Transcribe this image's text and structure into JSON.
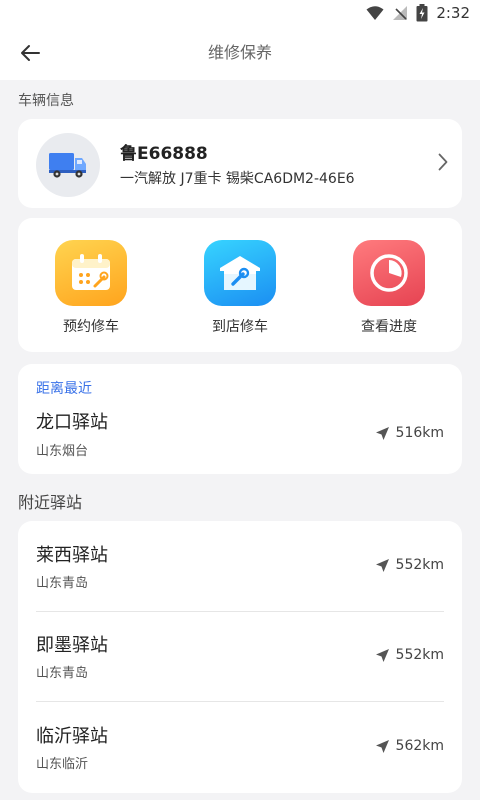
{
  "status_bar": {
    "time": "2:32"
  },
  "appbar": {
    "title": "维修保养"
  },
  "vehicle_section": {
    "label": "车辆信息"
  },
  "vehicle": {
    "plate": "鲁E66888",
    "model": "一汽解放 J7重卡 锡柴CA6DM2-46E6"
  },
  "actions": [
    {
      "label": "预约修车",
      "icon": "calendar-wrench-icon",
      "color_from": "#ffd450",
      "color_to": "#ffa41d"
    },
    {
      "label": "到店修车",
      "icon": "garage-wrench-icon",
      "color_from": "#37d4ff",
      "color_to": "#1b8ef2"
    },
    {
      "label": "查看进度",
      "icon": "progress-pie-icon",
      "color_from": "#ff7b7e",
      "color_to": "#e64352"
    }
  ],
  "nearest": {
    "tag": "距离最近",
    "station": {
      "name": "龙口驿站",
      "region": "山东烟台",
      "distance": "516km"
    }
  },
  "nearby_section": {
    "label": "附近驿站"
  },
  "nearby": [
    {
      "name": "莱西驿站",
      "region": "山东青岛",
      "distance": "552km"
    },
    {
      "name": "即墨驿站",
      "region": "山东青岛",
      "distance": "552km"
    },
    {
      "name": "临沂驿站",
      "region": "山东临沂",
      "distance": "562km"
    }
  ],
  "colors": {
    "accent_blue": "#3a72e8",
    "background": "#f3f3f5"
  }
}
